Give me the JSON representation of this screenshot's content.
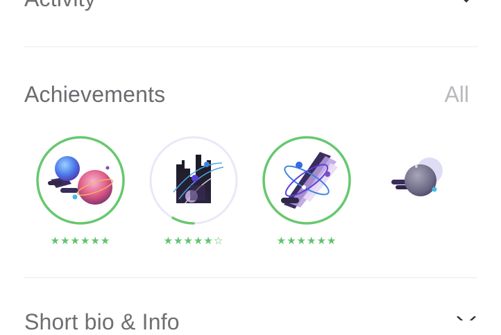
{
  "sections": {
    "activity": {
      "title": "Activity"
    },
    "achievements": {
      "title": "Achievements",
      "all_link": "All"
    },
    "bio": {
      "title": "Short bio & Info"
    }
  },
  "badges": [
    {
      "icon": "planets-badge-icon",
      "progress": 1.0,
      "rating": 6,
      "max_rating": 6
    },
    {
      "icon": "city-orbit-badge-icon",
      "progress": 0.2,
      "rating": 5,
      "max_rating": 6
    },
    {
      "icon": "atom-rocket-badge-icon",
      "progress": 1.0,
      "rating": 6,
      "max_rating": 6
    },
    {
      "icon": "comet-planet-badge-icon",
      "progress": 0,
      "rating": 0,
      "max_rating": 0
    }
  ],
  "colors": {
    "ring_complete": "#66c86e",
    "ring_track": "#e9e8f7",
    "star": "#5ec46a",
    "title": "#6e6e73",
    "link": "#b9b9be"
  }
}
